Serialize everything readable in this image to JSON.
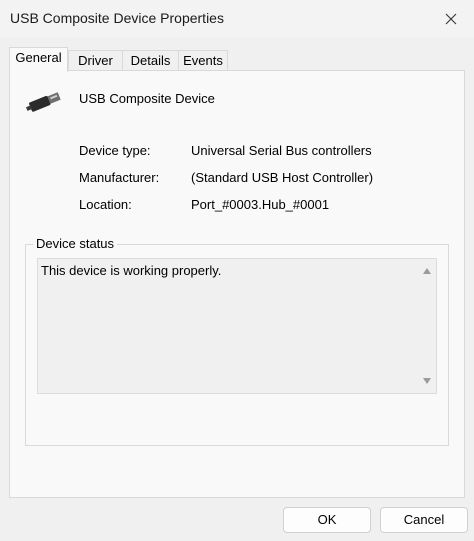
{
  "window": {
    "title": "USB Composite Device Properties"
  },
  "tabs": [
    {
      "label": "General",
      "active": true
    },
    {
      "label": "Driver"
    },
    {
      "label": "Details"
    },
    {
      "label": "Events"
    }
  ],
  "device": {
    "icon": "usb-connector-icon",
    "name": "USB Composite Device"
  },
  "properties": [
    {
      "label": "Device type:",
      "value": "Universal Serial Bus controllers"
    },
    {
      "label": "Manufacturer:",
      "value": "(Standard USB Host Controller)"
    },
    {
      "label": "Location:",
      "value": "Port_#0003.Hub_#0001"
    }
  ],
  "status": {
    "group_label": "Device status",
    "text": "This device is working properly."
  },
  "buttons": {
    "ok": "OK",
    "cancel": "Cancel"
  }
}
